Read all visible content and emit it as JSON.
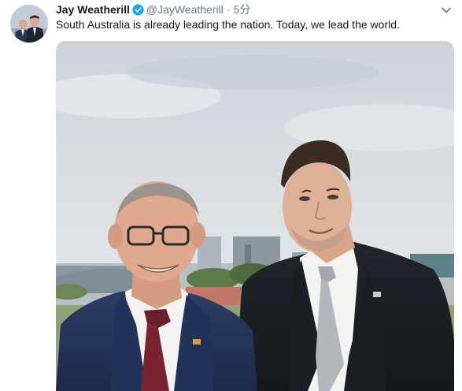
{
  "tweet": {
    "display_name": "Jay Weatherill",
    "handle": "@JayWeatherill",
    "separator": "·",
    "timestamp": "5分",
    "text": "South Australia is already leading the nation. Today, we lead the world.",
    "verified": true
  },
  "icons": {
    "verified": "verified-badge-icon",
    "more": "chevron-down-icon"
  },
  "colors": {
    "name": "#14171a",
    "secondary": "#657786",
    "verified_blue": "#1da1f2"
  }
}
